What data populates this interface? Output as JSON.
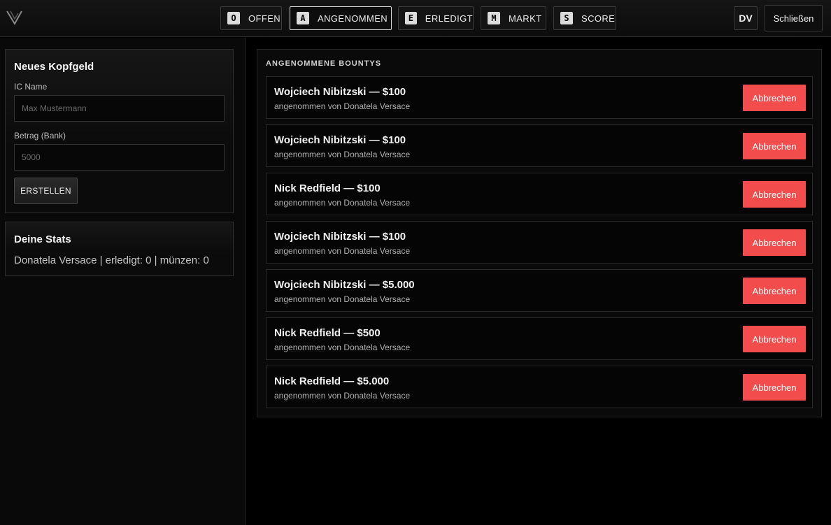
{
  "header": {
    "logo_icon": "v-logo-icon",
    "tabs": [
      {
        "key": "O",
        "label": "OFFEN",
        "active": false
      },
      {
        "key": "A",
        "label": "ANGENOMMEN",
        "active": true
      },
      {
        "key": "E",
        "label": "ERLEDIGT",
        "active": false
      },
      {
        "key": "M",
        "label": "MARKT",
        "active": false
      },
      {
        "key": "S",
        "label": "SCORE",
        "active": false
      }
    ],
    "avatar": "DV",
    "close_label": "Schließen"
  },
  "new_bounty": {
    "title": "Neues Kopfgeld",
    "name_label": "IC Name",
    "name_placeholder": "Max Mustermann",
    "amount_label": "Betrag (Bank)",
    "amount_placeholder": "5000",
    "create_label": "ERSTELLEN"
  },
  "stats": {
    "title": "Deine Stats",
    "line": "Donatela Versace | erledigt: 0 | münzen: 0"
  },
  "accepted": {
    "title": "ANGENOMMENE BOUNTYS",
    "cancel_label": "Abbrechen",
    "items": [
      {
        "title": "Wojciech Nibitzski — $100",
        "sub": "angenommen von Donatela Versace"
      },
      {
        "title": "Wojciech Nibitzski — $100",
        "sub": "angenommen von Donatela Versace"
      },
      {
        "title": "Nick Redfield — $100",
        "sub": "angenommen von Donatela Versace"
      },
      {
        "title": "Wojciech Nibitzski — $100",
        "sub": "angenommen von Donatela Versace"
      },
      {
        "title": "Wojciech Nibitzski — $5.000",
        "sub": "angenommen von Donatela Versace"
      },
      {
        "title": "Nick Redfield — $500",
        "sub": "angenommen von Donatela Versace"
      },
      {
        "title": "Nick Redfield — $5.000",
        "sub": "angenommen von Donatela Versace"
      }
    ]
  },
  "colors": {
    "accent_danger": "#f24c4c",
    "background": "#000000",
    "panel": "#0a0a0a",
    "active_tab_border": "#d8d8d8"
  }
}
